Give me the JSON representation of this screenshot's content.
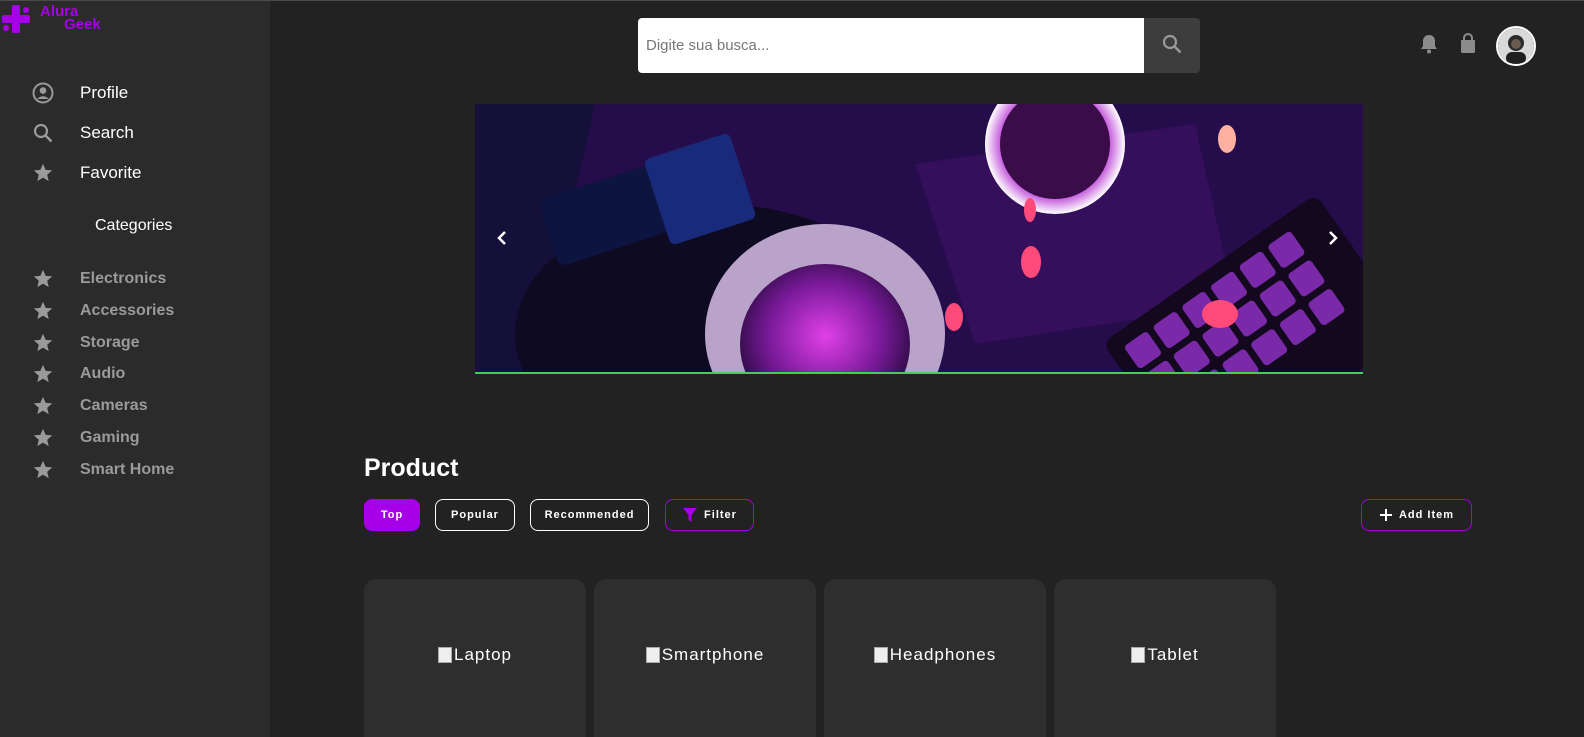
{
  "logo": {
    "line1": "Alura",
    "line2": "Geek"
  },
  "nav": [
    {
      "label": "Profile",
      "icon": "profile-icon"
    },
    {
      "label": "Search",
      "icon": "search-icon"
    },
    {
      "label": "Favorite",
      "icon": "star-icon"
    }
  ],
  "categories": {
    "title": "Categories",
    "items": [
      {
        "label": "Electronics"
      },
      {
        "label": "Accessories"
      },
      {
        "label": "Storage"
      },
      {
        "label": "Audio"
      },
      {
        "label": "Cameras"
      },
      {
        "label": "Gaming"
      },
      {
        "label": "Smart Home"
      }
    ]
  },
  "header": {
    "search_placeholder": "Digite sua busca..."
  },
  "products": {
    "title": "Product",
    "filters": {
      "top": "Top",
      "popular": "Popular",
      "recommended": "Recommended",
      "filter": "Filter"
    },
    "add_item": "Add Item",
    "cards": [
      {
        "alt": "Laptop"
      },
      {
        "alt": "Smartphone"
      },
      {
        "alt": "Headphones"
      },
      {
        "alt": "Tablet"
      }
    ]
  },
  "colors": {
    "accent": "#a600e8",
    "sidebar": "#2b2b2b",
    "background": "#222222",
    "banner_underline": "#3bd15a"
  }
}
